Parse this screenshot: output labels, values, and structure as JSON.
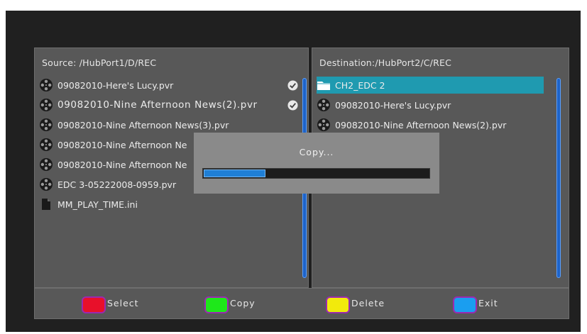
{
  "source": {
    "path": "Source: /HubPort1/D/REC",
    "files": [
      {
        "name": "09082010-Here's Lucy.pvr",
        "icon": "film-reel-icon",
        "checked": true
      },
      {
        "name": "09082010-Nine Afternoon News(2).pvr",
        "icon": "film-reel-icon",
        "checked": true
      },
      {
        "name": "09082010-Nine Afternoon News(3).pvr",
        "icon": "film-reel-icon",
        "checked": false
      },
      {
        "name": "09082010-Nine Afternoon Ne",
        "icon": "film-reel-icon",
        "checked": false
      },
      {
        "name": "09082010-Nine Afternoon Ne",
        "icon": "film-reel-icon",
        "checked": false
      },
      {
        "name": "EDC 3-05222008-0959.pvr",
        "icon": "film-reel-icon",
        "checked": false
      },
      {
        "name": "MM_PLAY_TIME.ini",
        "icon": "document-icon",
        "checked": false
      }
    ]
  },
  "destination": {
    "path": "Destination:/HubPort2/C/REC",
    "files": [
      {
        "name": "CH2_EDC 2",
        "icon": "folder-icon",
        "selected": true
      },
      {
        "name": "09082010-Here's Lucy.pvr",
        "icon": "film-reel-icon",
        "selected": false
      },
      {
        "name": "09082010-Nine Afternoon News(2).pvr",
        "icon": "film-reel-icon",
        "selected": false
      }
    ]
  },
  "dialog": {
    "title": "Copy...",
    "progress": 0.28
  },
  "actions": [
    {
      "label": "Select",
      "color": "#e8102a"
    },
    {
      "label": "Copy",
      "color": "#1ee81a"
    },
    {
      "label": "Delete",
      "color": "#f2ea0c"
    },
    {
      "label": "Exit",
      "color": "#1a9ef0"
    }
  ]
}
